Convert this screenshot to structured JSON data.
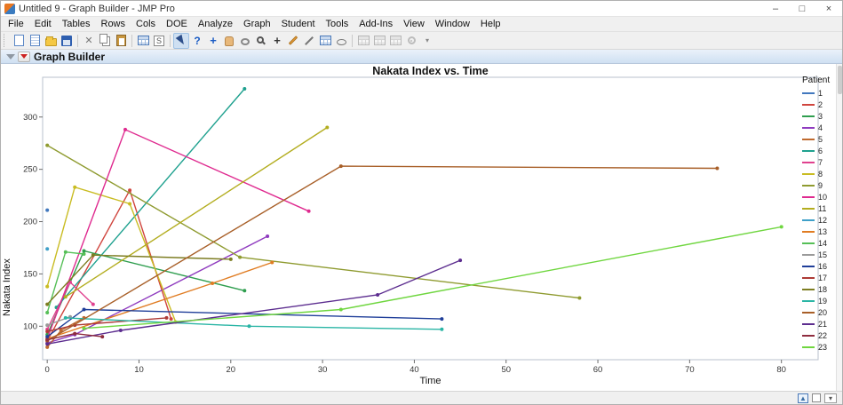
{
  "window": {
    "title": "Untitled 9 - Graph Builder - JMP Pro"
  },
  "menubar": {
    "items": [
      "File",
      "Edit",
      "Tables",
      "Rows",
      "Cols",
      "DOE",
      "Analyze",
      "Graph",
      "Student",
      "Tools",
      "Add-Ins",
      "View",
      "Window",
      "Help"
    ]
  },
  "toolbar": {
    "icons": [
      "new-data-table",
      "new-journal",
      "open-folder",
      "save",
      "cut",
      "copy",
      "paste",
      "data-table",
      "script-window",
      "arrow-tool",
      "help-tool",
      "crosshair-tool",
      "grabber-tool",
      "lasso-tool",
      "magnifier-tool",
      "annotate-plus-tool",
      "pencil-tool",
      "line-tool",
      "layout-table",
      "shape-tool",
      "table-disabled-1",
      "table-disabled-2",
      "table-disabled-3",
      "settings-gear",
      "more-dropdown"
    ]
  },
  "report": {
    "section_title": "Graph Builder"
  },
  "statusbar": {
    "icons": [
      "dock-icon",
      "caret-up-icon",
      "status-checkbox",
      "status-dropdown"
    ]
  },
  "chart_data": {
    "type": "line",
    "title": "Nakata Index vs. Time",
    "xlabel": "Time",
    "ylabel": "Nakata Index",
    "legend_title": "Patient",
    "legend_position": "right",
    "grid": false,
    "xlim": [
      -0.5,
      84
    ],
    "ylim": [
      68,
      338
    ],
    "xticks": [
      0,
      10,
      20,
      30,
      40,
      50,
      60,
      70,
      80
    ],
    "yticks": [
      100,
      150,
      200,
      250,
      300
    ],
    "series": [
      {
        "name": "1",
        "color": "#4178be",
        "points": [
          [
            0,
            211
          ]
        ]
      },
      {
        "name": "2",
        "color": "#d0453e",
        "points": [
          [
            0,
            86
          ],
          [
            9,
            230
          ],
          [
            13.5,
            107
          ]
        ]
      },
      {
        "name": "3",
        "color": "#2f9e4f",
        "points": [
          [
            0,
            92
          ],
          [
            4,
            172
          ],
          [
            21.5,
            134
          ]
        ]
      },
      {
        "name": "4",
        "color": "#8f3bbf",
        "points": [
          [
            0,
            84
          ],
          [
            3,
            92
          ],
          [
            24,
            186
          ]
        ]
      },
      {
        "name": "5",
        "color": "#bf6a2f",
        "points": [
          [
            0,
            80
          ],
          [
            1.5,
            96
          ],
          [
            4,
            108
          ]
        ]
      },
      {
        "name": "6",
        "color": "#1fa18f",
        "points": [
          [
            1,
            118
          ],
          [
            21.5,
            327
          ]
        ]
      },
      {
        "name": "7",
        "color": "#e0418f",
        "points": [
          [
            0,
            97
          ],
          [
            2.5,
            142
          ],
          [
            5,
            121
          ]
        ]
      },
      {
        "name": "8",
        "color": "#c9bc22",
        "points": [
          [
            0,
            138
          ],
          [
            3,
            233
          ],
          [
            9,
            217
          ],
          [
            14,
            104
          ]
        ]
      },
      {
        "name": "9",
        "color": "#8f9b30",
        "points": [
          [
            0,
            273
          ],
          [
            21,
            166
          ],
          [
            58,
            127
          ]
        ]
      },
      {
        "name": "10",
        "color": "#df2a8f",
        "points": [
          [
            0,
            88
          ],
          [
            8.5,
            288
          ],
          [
            28.5,
            210
          ]
        ]
      },
      {
        "name": "11",
        "color": "#b3ad1f",
        "points": [
          [
            2,
            128
          ],
          [
            30.5,
            290
          ]
        ]
      },
      {
        "name": "12",
        "color": "#3fa0c9",
        "points": [
          [
            0,
            174
          ]
        ]
      },
      {
        "name": "13",
        "color": "#e07c22",
        "points": [
          [
            0,
            88
          ],
          [
            18,
            141
          ],
          [
            24.5,
            161
          ]
        ]
      },
      {
        "name": "14",
        "color": "#55bf57",
        "points": [
          [
            0,
            113
          ],
          [
            2,
            171
          ],
          [
            4,
            169
          ]
        ]
      },
      {
        "name": "15",
        "color": "#9a9a9a",
        "points": [
          [
            0,
            101
          ],
          [
            2.5,
            109
          ]
        ]
      },
      {
        "name": "16",
        "color": "#1f3e99",
        "points": [
          [
            0,
            90
          ],
          [
            4,
            116
          ],
          [
            43,
            107
          ]
        ]
      },
      {
        "name": "17",
        "color": "#ad3a36",
        "points": [
          [
            0,
            95
          ],
          [
            3,
            101
          ],
          [
            13,
            108
          ]
        ]
      },
      {
        "name": "18",
        "color": "#7d7d22",
        "points": [
          [
            0,
            121
          ],
          [
            5,
            168
          ],
          [
            20,
            164
          ]
        ]
      },
      {
        "name": "19",
        "color": "#2ab5a5",
        "points": [
          [
            2,
            108
          ],
          [
            22,
            100
          ],
          [
            43,
            97
          ]
        ]
      },
      {
        "name": "20",
        "color": "#a85f28",
        "points": [
          [
            0,
            86
          ],
          [
            32,
            253
          ],
          [
            73,
            251
          ]
        ]
      },
      {
        "name": "21",
        "color": "#5c2d8f",
        "points": [
          [
            0,
            83
          ],
          [
            8,
            96
          ],
          [
            36,
            130
          ],
          [
            45,
            163
          ]
        ]
      },
      {
        "name": "22",
        "color": "#8f2d3f",
        "points": [
          [
            0,
            87
          ],
          [
            3,
            93
          ],
          [
            6,
            90
          ]
        ]
      },
      {
        "name": "23",
        "color": "#6fd63f",
        "points": [
          [
            4,
            98
          ],
          [
            32,
            116
          ],
          [
            80,
            195
          ]
        ]
      }
    ]
  }
}
